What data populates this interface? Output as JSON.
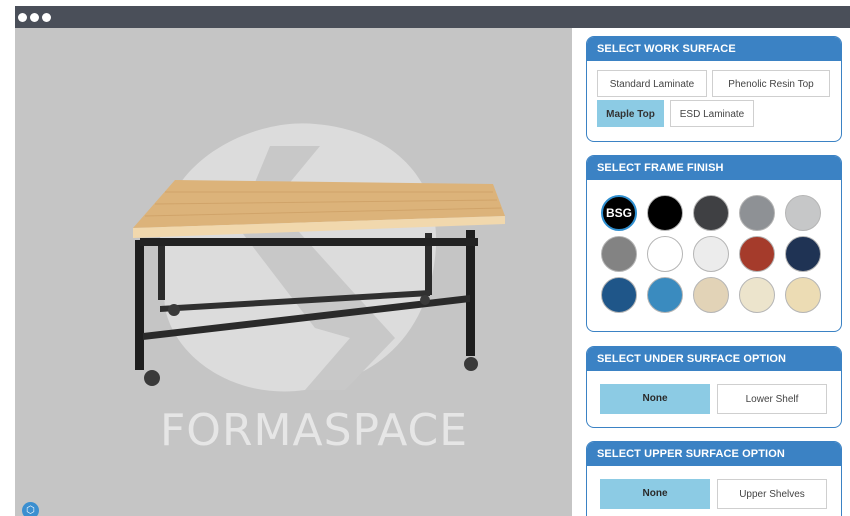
{
  "window": {
    "controls": [
      "close",
      "minimize",
      "maximize"
    ]
  },
  "viewer": {
    "brand_text": "FORMASPACE",
    "model": "workbench",
    "corner_icon": "cube-icon"
  },
  "work_surface": {
    "title": "SELECT WORK SURFACE",
    "options": [
      {
        "label": "Standard Laminate",
        "selected": false
      },
      {
        "label": "Phenolic Resin Top",
        "selected": false
      },
      {
        "label": "Maple Top",
        "selected": true
      },
      {
        "label": "ESD Laminate",
        "selected": false
      }
    ]
  },
  "frame_finish": {
    "title": "SELECT FRAME FINISH",
    "swatches": [
      {
        "label": "BSG",
        "color": "#000000",
        "selected": true
      },
      {
        "label": "",
        "color": "#000000",
        "selected": false
      },
      {
        "label": "",
        "color": "#3f4043",
        "selected": false
      },
      {
        "label": "",
        "color": "#8e9195",
        "selected": false
      },
      {
        "label": "",
        "color": "#c6c7c8",
        "selected": false
      },
      {
        "label": "",
        "color": "#838383",
        "selected": false
      },
      {
        "label": "",
        "color": "#ffffff",
        "selected": false
      },
      {
        "label": "",
        "color": "#ececec",
        "selected": false
      },
      {
        "label": "",
        "color": "#a53b2b",
        "selected": false
      },
      {
        "label": "",
        "color": "#1f3354",
        "selected": false
      },
      {
        "label": "",
        "color": "#1f5689",
        "selected": false
      },
      {
        "label": "",
        "color": "#3a8bbf",
        "selected": false
      },
      {
        "label": "",
        "color": "#e2d3b7",
        "selected": false
      },
      {
        "label": "",
        "color": "#ece4cc",
        "selected": false
      },
      {
        "label": "",
        "color": "#ecdcb4",
        "selected": false
      }
    ]
  },
  "under_surface": {
    "title": "SELECT UNDER SURFACE OPTION",
    "options": [
      {
        "label": "None",
        "selected": true
      },
      {
        "label": "Lower Shelf",
        "selected": false
      }
    ]
  },
  "upper_surface": {
    "title": "SELECT UPPER SURFACE OPTION",
    "options": [
      {
        "label": "None",
        "selected": true
      },
      {
        "label": "Upper Shelves",
        "selected": false
      }
    ]
  },
  "colors": {
    "accent": "#3b82c4",
    "selected_button": "#8ccbe4"
  }
}
